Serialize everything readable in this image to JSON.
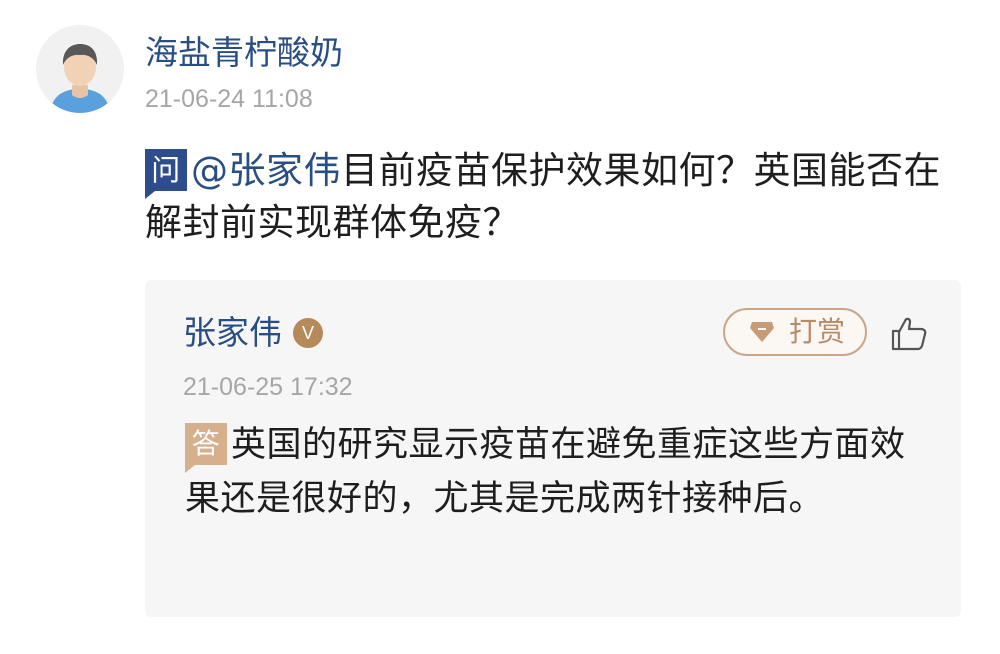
{
  "question": {
    "username": "海盐青柠酸奶",
    "time": "21-06-24 11:08",
    "badge": "问",
    "mention": "@张家伟",
    "text": "目前疫苗保护效果如何？英国能否在解封前实现群体免疫？"
  },
  "answer": {
    "username": "张家伟",
    "verified_badge": "V",
    "tip_label": "打赏",
    "time": "21-06-25 17:32",
    "badge": "答",
    "text": "英国的研究显示疫苗在避免重症这些方面效果还是很好的，尤其是完成两针接种后。"
  },
  "colors": {
    "link_blue": "#294e83",
    "question_badge": "#2e4d8c",
    "answer_badge": "#d6b08c",
    "tip_accent": "#caa78b",
    "timestamp_gray": "#a6a6a6",
    "card_background": "#f6f6f6"
  },
  "icons": {
    "avatar": "default-user-avatar",
    "tip": "diamond-gift-icon",
    "like": "thumbs-up-icon",
    "verified": "verified-v-icon"
  }
}
